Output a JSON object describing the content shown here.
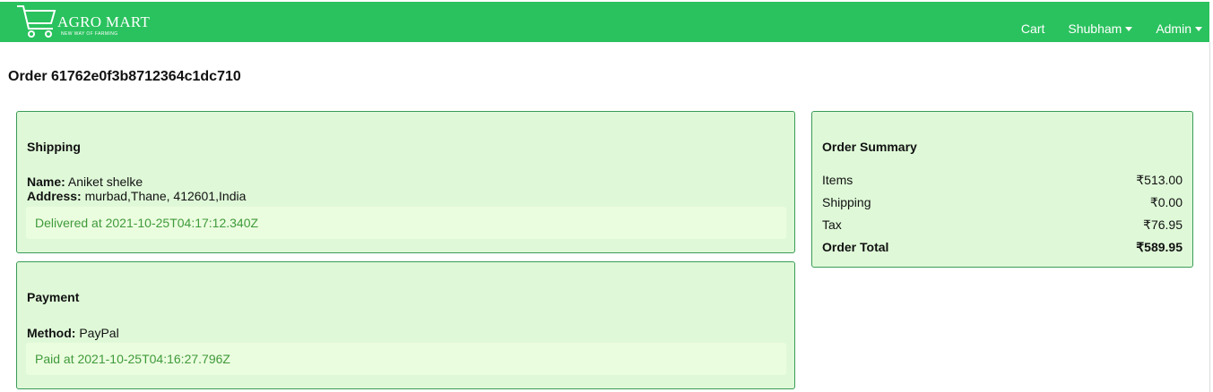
{
  "navbar": {
    "brand_name": "AGRO MART",
    "brand_tagline": "NEW WAY OF FARMING",
    "cart_label": "Cart",
    "user_label": "Shubham",
    "admin_label": "Admin",
    "bg_color": "#2ac25e"
  },
  "order": {
    "title": "Order 61762e0f3b8712364c1dc710"
  },
  "shipping": {
    "heading": "Shipping",
    "name_label": "Name:",
    "name_value": "Aniket shelke",
    "address_label": "Address:",
    "address_value": "murbad,Thane, 412601,India",
    "status": "Delivered at 2021-10-25T04:17:12.340Z"
  },
  "payment": {
    "heading": "Payment",
    "method_label": "Method:",
    "method_value": "PayPal",
    "status": "Paid at 2021-10-25T04:16:27.796Z"
  },
  "summary": {
    "heading": "Order Summary",
    "rows": [
      {
        "label": "Items",
        "value": "₹513.00"
      },
      {
        "label": "Shipping",
        "value": "₹0.00"
      },
      {
        "label": "Tax",
        "value": "₹76.95"
      },
      {
        "label": "Order Total",
        "value": "₹589.95"
      }
    ]
  },
  "colors": {
    "card_bg": "#dff9d8",
    "card_border": "#3a9b58",
    "status_bg": "#ebfddf",
    "status_text": "#3f9a3b"
  }
}
